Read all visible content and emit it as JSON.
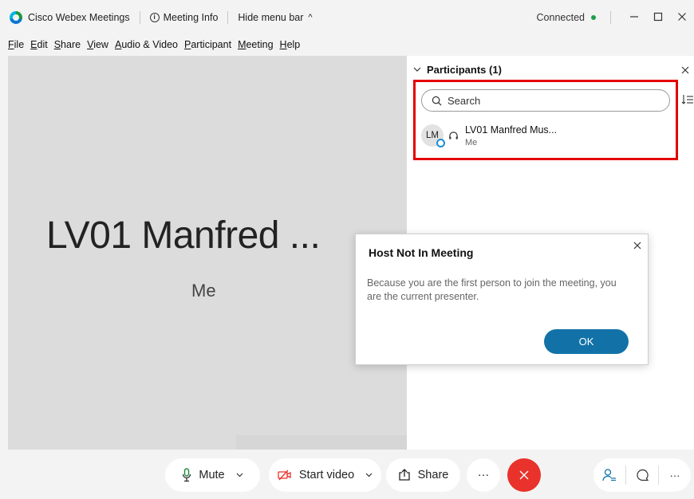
{
  "titlebar": {
    "app_title": "Cisco Webex Meetings",
    "meeting_info": "Meeting Info",
    "hide_menu": "Hide menu bar",
    "connection_status": "Connected"
  },
  "menu": [
    {
      "underline": "F",
      "rest": "ile"
    },
    {
      "underline": "E",
      "rest": "dit"
    },
    {
      "underline": "S",
      "rest": "hare"
    },
    {
      "underline": "V",
      "rest": "iew"
    },
    {
      "underline": "A",
      "rest": "udio & Video"
    },
    {
      "underline": "P",
      "rest": "articipant"
    },
    {
      "underline": "M",
      "rest": "eeting"
    },
    {
      "underline": "H",
      "rest": "elp"
    }
  ],
  "stage": {
    "name": "LV01 Manfred ...",
    "role": "Me"
  },
  "participants_panel": {
    "title": "Participants (1)",
    "search_placeholder": "Search",
    "participants": [
      {
        "initials": "LM",
        "name": "LV01 Manfred Mus...",
        "role": "Me"
      }
    ]
  },
  "dialog": {
    "title": "Host Not In Meeting",
    "message": "Because you are the first person to join the meeting, you are the current presenter.",
    "ok_label": "OK"
  },
  "controls": {
    "mute_label": "Mute",
    "video_label": "Start video",
    "share_label": "Share",
    "more_label": "···"
  },
  "colors": {
    "accent": "#1272a8",
    "end_call": "#e8322b",
    "connected": "#1d9e4a",
    "highlight": "#e30000"
  }
}
